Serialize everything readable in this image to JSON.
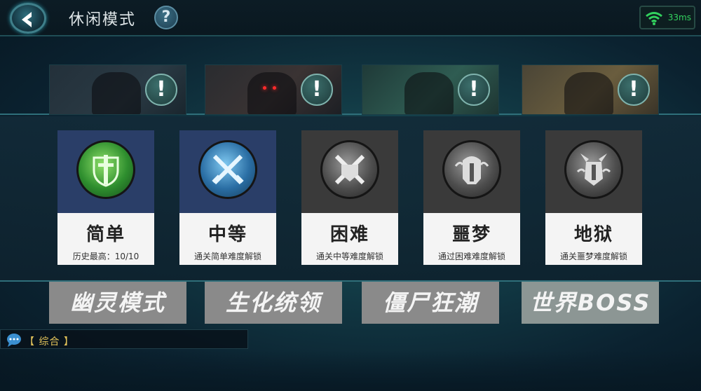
{
  "header": {
    "title": "休闲模式",
    "help_label": "?",
    "ping": "33ms"
  },
  "modes": [
    {
      "label": "幽灵模式",
      "icon": "!"
    },
    {
      "label": "生化统领",
      "icon": "!"
    },
    {
      "label": "僵尸狂潮",
      "icon": "!"
    },
    {
      "label": "世界BOSS",
      "icon": "!"
    }
  ],
  "difficulties": [
    {
      "name": "简单",
      "sub": "历史最高：10/10",
      "state": "unlocked",
      "icon": "green-sword-shield-icon"
    },
    {
      "name": "中等",
      "sub": "通关简单难度解锁",
      "state": "unlocked",
      "icon": "crossed-swords-icon"
    },
    {
      "name": "困难",
      "sub": "通关中等难度解锁",
      "state": "locked",
      "icon": "crossed-swords-skull-icon"
    },
    {
      "name": "噩梦",
      "sub": "通过困难难度解锁",
      "state": "locked",
      "icon": "helmet-icon"
    },
    {
      "name": "地狱",
      "sub": "通关噩梦难度解锁",
      "state": "locked",
      "icon": "demon-helmet-icon"
    }
  ],
  "chat": {
    "channel": "【 综合 】"
  },
  "colors": {
    "accent": "#2f6f7a",
    "unlocked_card": "#2a3e68",
    "locked_card": "#3a3a3a",
    "chat_channel": "#e3c35a",
    "ping": "#32d25e"
  }
}
